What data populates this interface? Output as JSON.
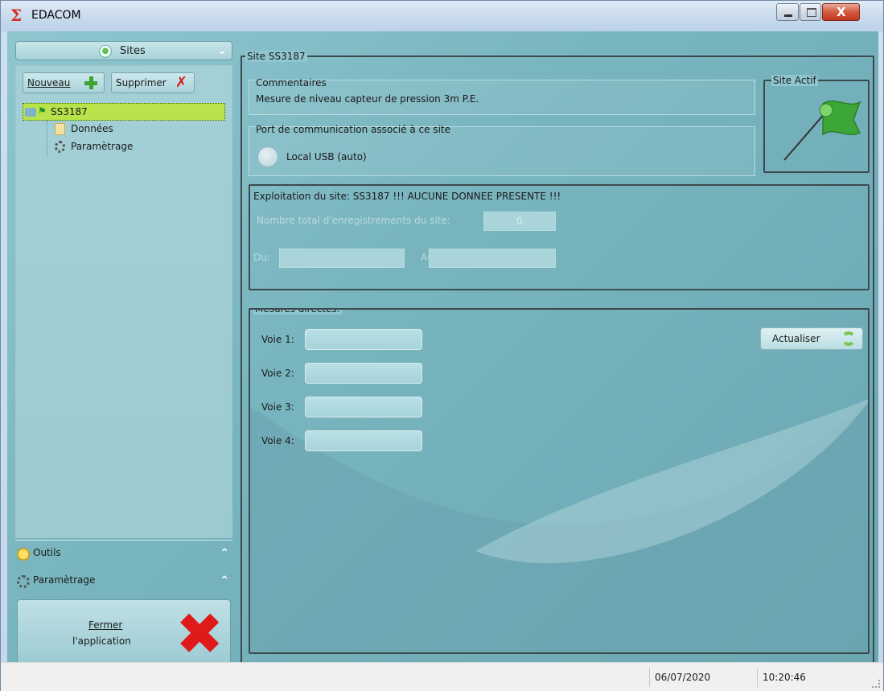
{
  "window": {
    "title": "EDACOM",
    "close_glyph": "X"
  },
  "left": {
    "sites_header": "Sites",
    "buttons": {
      "nouveau": "Nouveau",
      "supprimer": "Supprimer"
    },
    "tree": {
      "root": "SS3187",
      "children": [
        "Données",
        "Paramètrage"
      ]
    },
    "accordion": {
      "outils": "Outils",
      "parametrage": "Paramètrage"
    },
    "fermer": {
      "line1": "Fermer",
      "line2": "l'application"
    }
  },
  "site": {
    "group_title": "Site SS3187",
    "comment_title": "Commentaires",
    "comment_text": "Mesure de niveau capteur de pression 3m P.E.",
    "port_title": "Port de communication associé à ce site",
    "port_label": "Local USB (auto)",
    "actif_title": "Site Actif"
  },
  "exploit": {
    "title": "Exploitation du site: SS3187   !!! AUCUNE DONNEE PRESENTE !!!",
    "nb_label": "Nombre total d'enregistrements du site:",
    "nb_value": "0",
    "du_label": "Du:",
    "au_label": "Au:"
  },
  "mesures": {
    "title": "Mesures directes:",
    "voies": [
      "Voie 1:",
      "Voie 2:",
      "Voie 3:",
      "Voie 4:"
    ],
    "actualiser": "Actualiser"
  },
  "status": {
    "date": "06/07/2020",
    "time": "10:20:46"
  },
  "colors": {
    "accent_green": "#b8e34a",
    "background": "#8fc6cf",
    "close_red": "#de1a1a"
  }
}
